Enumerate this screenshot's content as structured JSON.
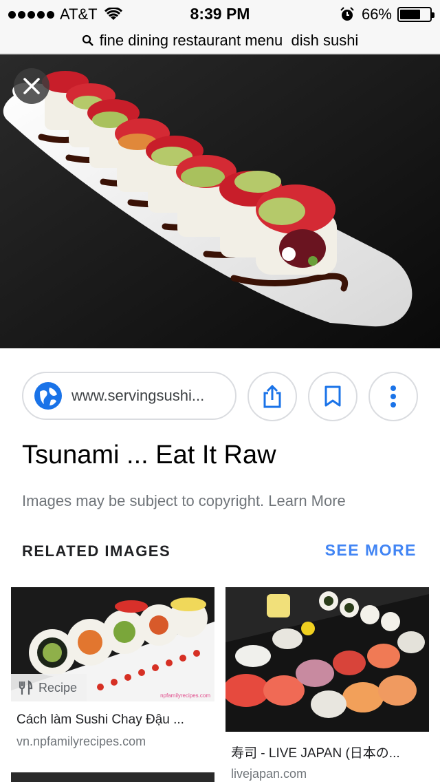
{
  "status_bar": {
    "carrier": "AT&T",
    "time": "8:39 PM",
    "battery": "66%",
    "battery_level": 0.66
  },
  "search": {
    "query": "fine dining restaurant menu  dish sushi",
    "icon": "search-icon"
  },
  "hero": {
    "close_icon": "close-icon"
  },
  "actions": {
    "url": "www.servingsushi...",
    "share_icon": "share-icon",
    "bookmark_icon": "bookmark-icon",
    "more_icon": "more-vert-icon"
  },
  "result": {
    "title": "Tsunami ... Eat It Raw",
    "copyright": "Images may be subject to copyright. Learn More"
  },
  "related": {
    "heading": "RELATED IMAGES",
    "see_more": "SEE MORE",
    "items": [
      {
        "title": "Cách làm Sushi Chay Đậu ...",
        "source": "vn.npfamilyrecipes.com",
        "badge": "Recipe",
        "watermark": "npfamilyrecipes.com"
      },
      {
        "title": "寿司 - LIVE JAPAN (日本の...",
        "source": "livejapan.com"
      }
    ]
  },
  "colors": {
    "accent": "#4285f4",
    "globe": "#1a73e8",
    "status_bg": "#f7f7f7"
  }
}
